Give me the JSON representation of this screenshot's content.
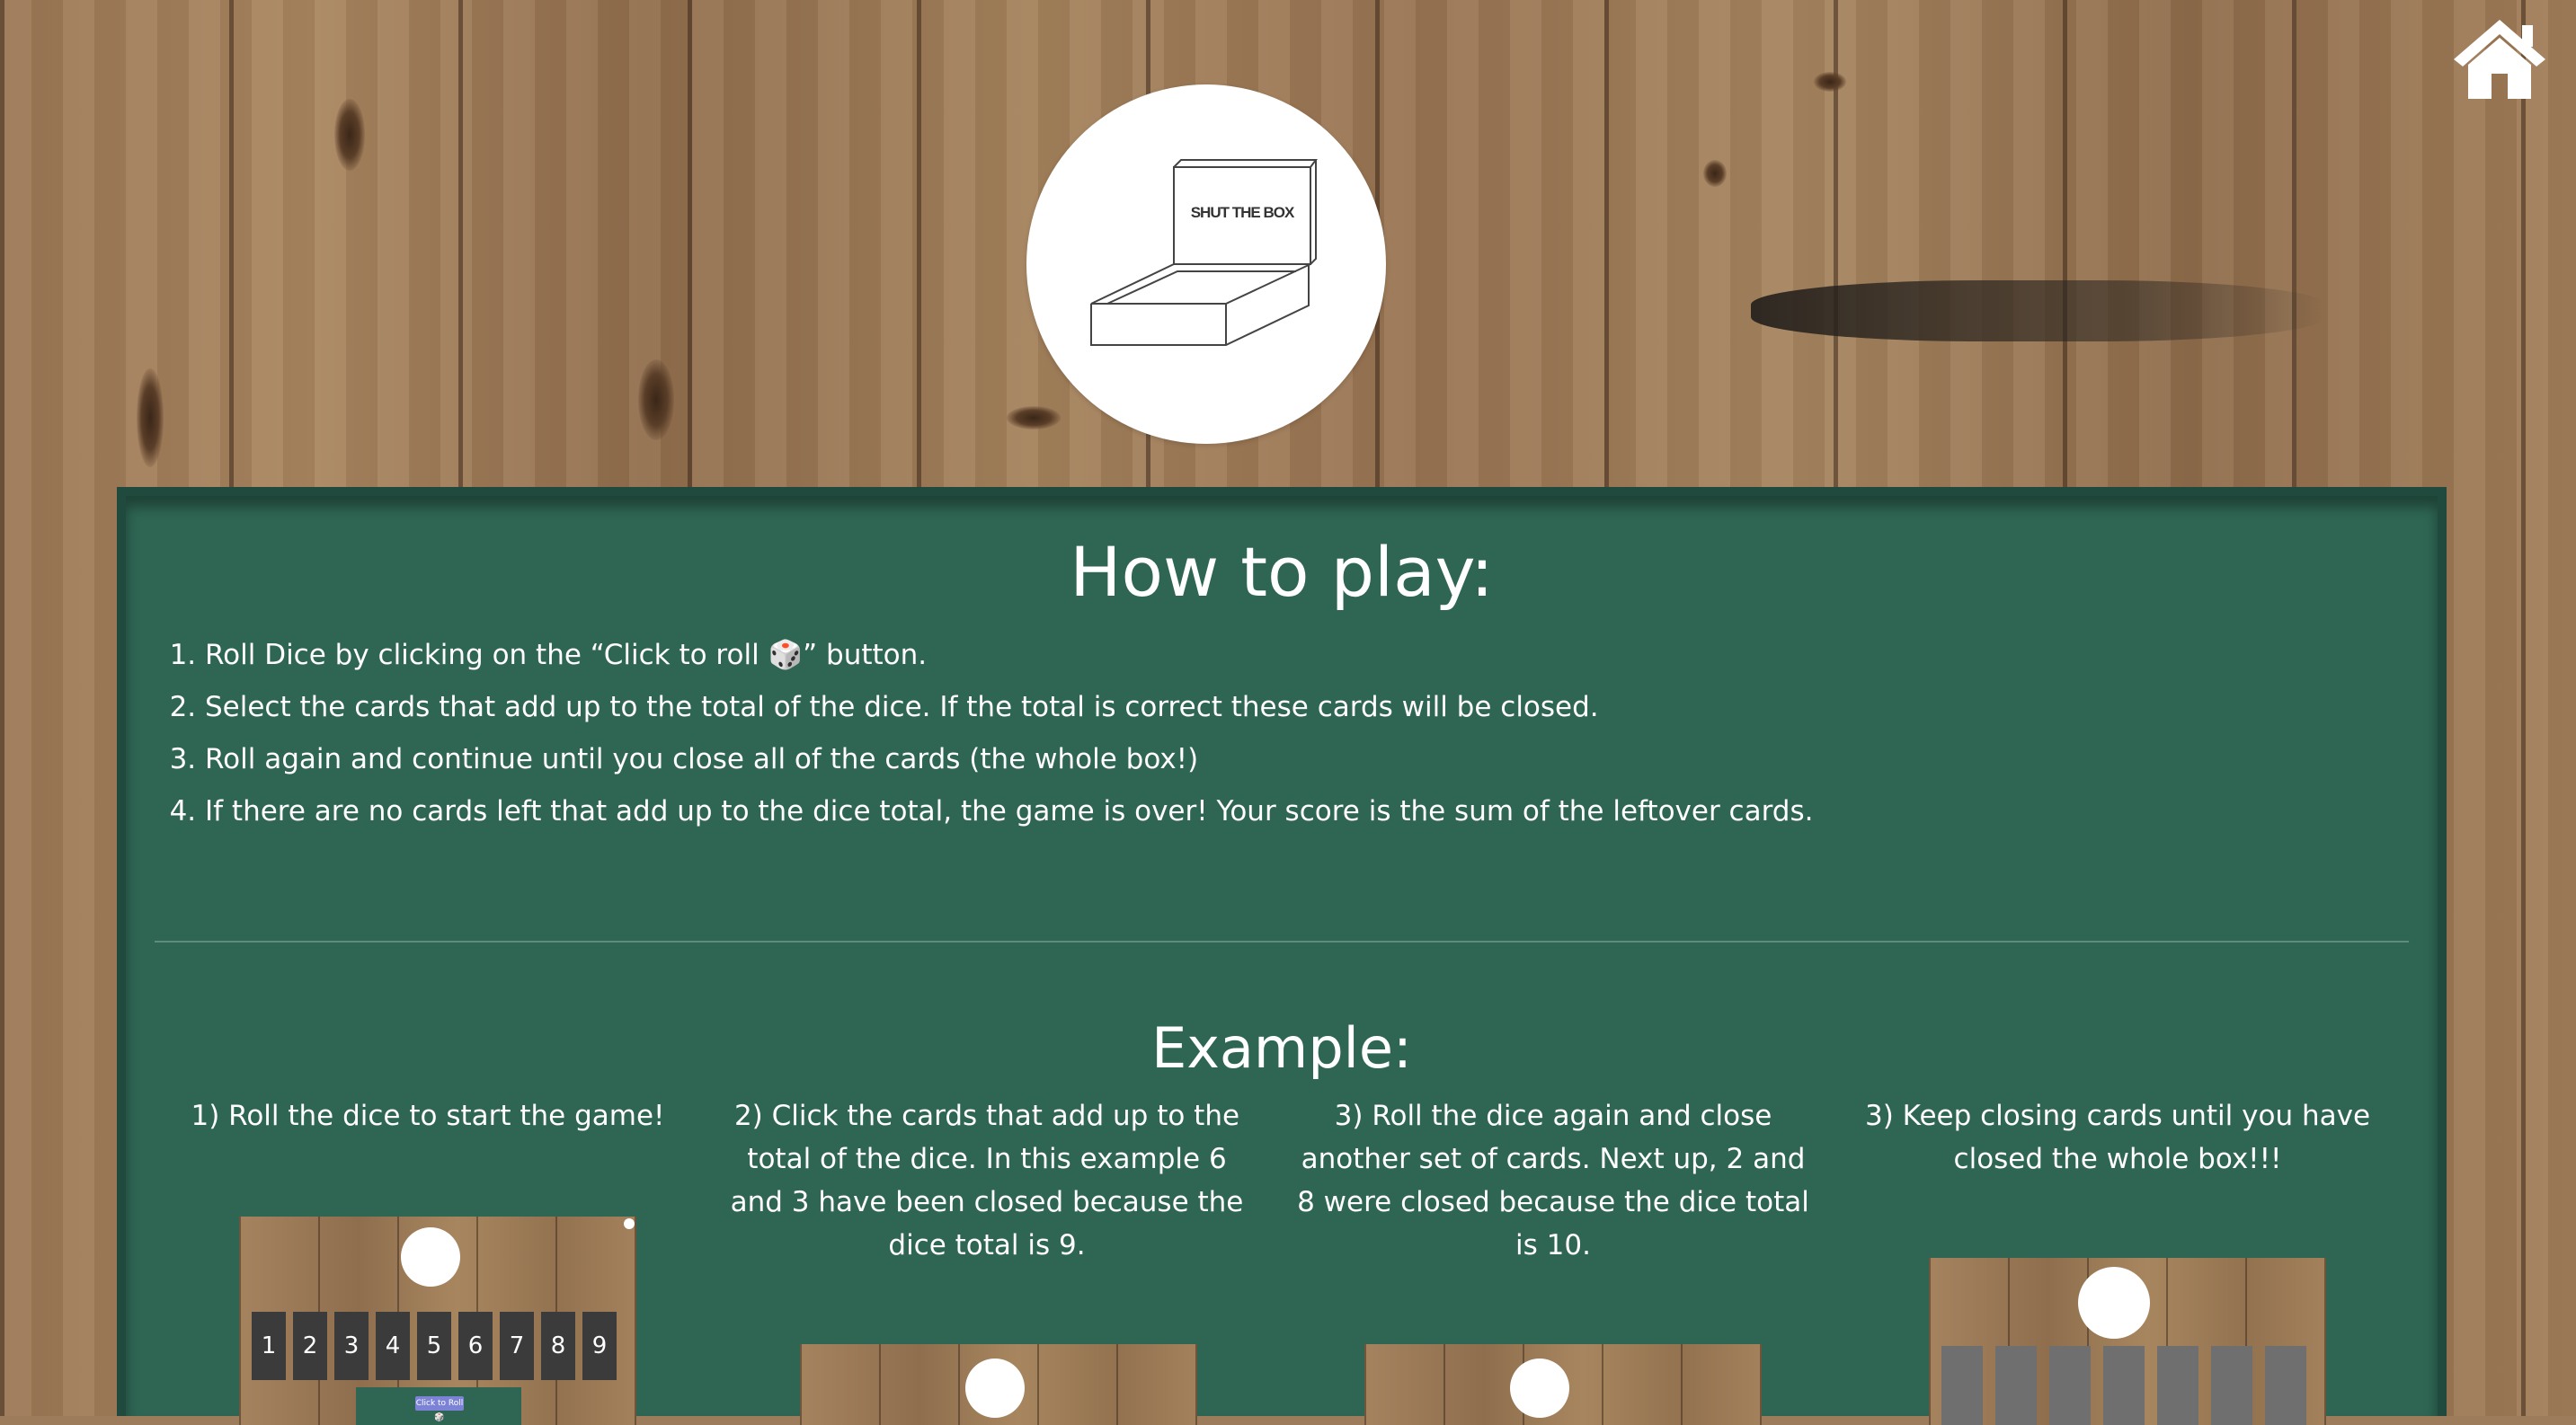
{
  "page": {
    "title": "How to play:",
    "steps": [
      "Roll Dice by clicking on the “Click to roll 🎲” button.",
      "Select the cards that add up to the total of the dice. If the total is correct these cards will be closed.",
      "Roll again and continue until you close all of the cards (the whole box!)",
      "If there are no cards left that add up to the dice total, the game is over! Your score is the sum of the leftover cards."
    ],
    "example_title": "Example:",
    "examples": [
      "1) Roll the dice to start the game!",
      "2) Click the cards that add up to the total of the dice. In this example 6 and 3 have been closed because the dice total is 9.",
      "3) Roll the dice again and close another set of cards. Next up, 2 and 8 were closed because the dice total is 10.",
      "3) Keep closing cards until you have closed the whole box!!!"
    ]
  },
  "logo": {
    "text": "SHUT THE BOX"
  },
  "thumb1": {
    "cards": [
      "1",
      "2",
      "3",
      "4",
      "5",
      "6",
      "7",
      "8",
      "9"
    ],
    "button": "Click to Roll 🎲"
  },
  "icons": {
    "home": "home-icon",
    "logo": "box-logo-icon"
  },
  "colors": {
    "panel": "#2e6553",
    "panel_border": "#1f4a3d",
    "card": "#3b3b3b",
    "closed_card": "#6f6f6f"
  }
}
